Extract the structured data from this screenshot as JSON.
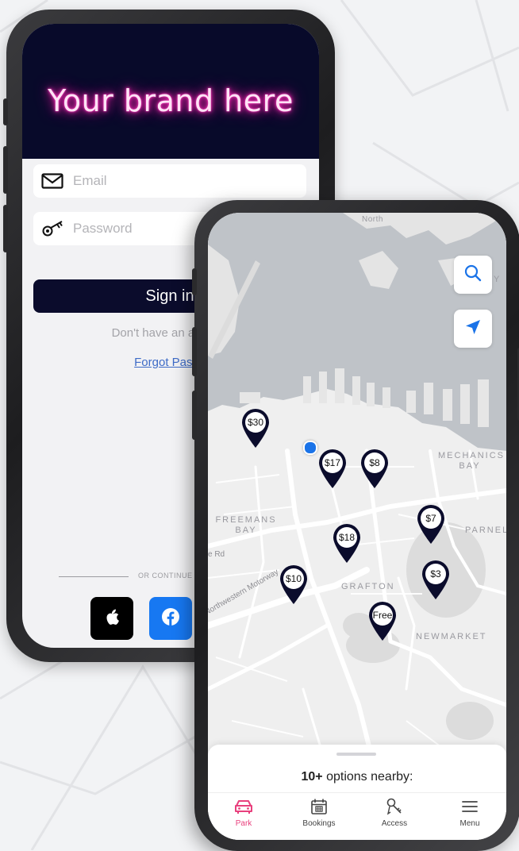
{
  "login_screen": {
    "brand_text": "Your brand here",
    "email_placeholder": "Email",
    "password_placeholder": "Password",
    "sign_in_label": "Sign in",
    "no_account_text": "Don't have an account",
    "forgot_password_text": "Forgot Passw",
    "continue_with_text": "OR CONTINUE W",
    "social_buttons": [
      "apple-icon",
      "facebook-icon"
    ]
  },
  "map_screen": {
    "area_labels": {
      "mechanics_bay": "MECHANICS BAY",
      "freemans_bay": "FREEMANS BAY",
      "parnell": "PARNEL",
      "grafton": "GRAFTON",
      "newmarket": "NEWMARKET",
      "north": "North",
      "y_edge": "Y"
    },
    "road_labels": {
      "motorway": "Northwestern Motorway",
      "rd": "e Rd"
    },
    "price_pins": [
      "$30",
      "$17",
      "$8",
      "$7",
      "$18",
      "$10",
      "$3",
      "Free"
    ],
    "search_icon": "search-icon",
    "locate_icon": "location-arrow-icon",
    "sheet_title": {
      "count": "10+",
      "suffix": " options nearby:"
    },
    "tabs": [
      {
        "label": "Park",
        "icon": "car-icon"
      },
      {
        "label": "Bookings",
        "icon": "calendar-icon"
      },
      {
        "label": "Access",
        "icon": "keys-icon"
      },
      {
        "label": "Menu",
        "icon": "menu-icon"
      }
    ],
    "colors": {
      "active_tab": "#e8407d",
      "pin": "#0b0c2c",
      "accent_blue": "#1a73e8"
    }
  }
}
